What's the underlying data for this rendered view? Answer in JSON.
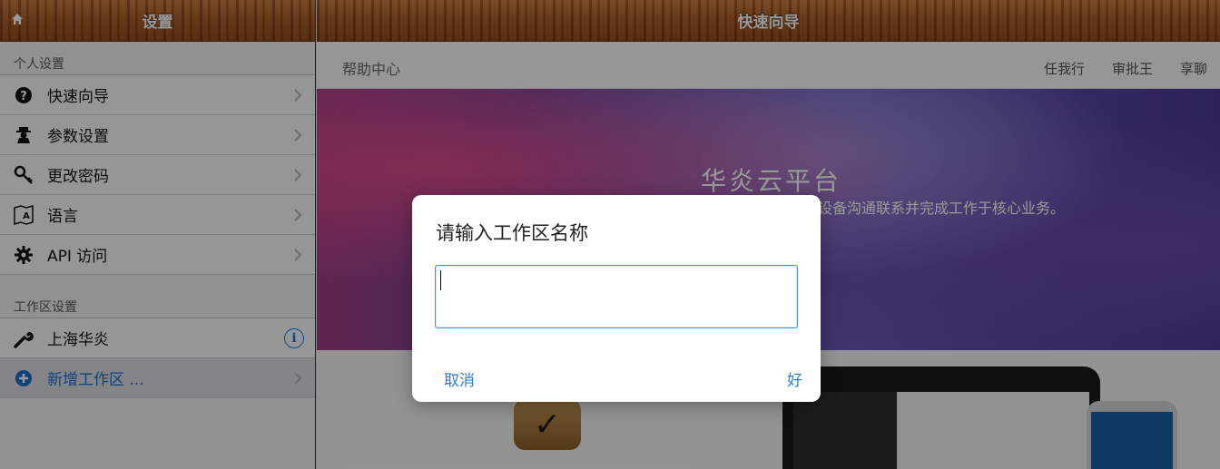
{
  "left_panel": {
    "title": "设置",
    "personal_section": "个人设置",
    "personal_items": [
      {
        "label": "快速向导",
        "icon": "question-circle-icon"
      },
      {
        "label": "参数设置",
        "icon": "agent-icon"
      },
      {
        "label": "更改密码",
        "icon": "key-icon"
      },
      {
        "label": "语言",
        "icon": "language-map-icon"
      },
      {
        "label": "API 访问",
        "icon": "gear-icon"
      }
    ],
    "workspace_section": "工作区设置",
    "workspace_items": [
      {
        "label": "上海华炎",
        "icon": "wrench-icon"
      },
      {
        "label": "新增工作区 ...",
        "icon": "plus-circle-icon"
      }
    ]
  },
  "right_panel": {
    "title": "快速向导",
    "help_center": "帮助中心",
    "nav_links": [
      "任我行",
      "审批王",
      "享聊"
    ],
    "hero_title": "华炎云平台",
    "hero_desc": "时随地使用任意设备沟通联系并完成工作于核心业务。"
  },
  "dialog": {
    "title": "请输入工作区名称",
    "input_value": "",
    "cancel": "取消",
    "ok": "好"
  },
  "colors": {
    "accent": "#2c7ed6",
    "wood": "#a55a24",
    "add_label": "#1e6fd0"
  }
}
